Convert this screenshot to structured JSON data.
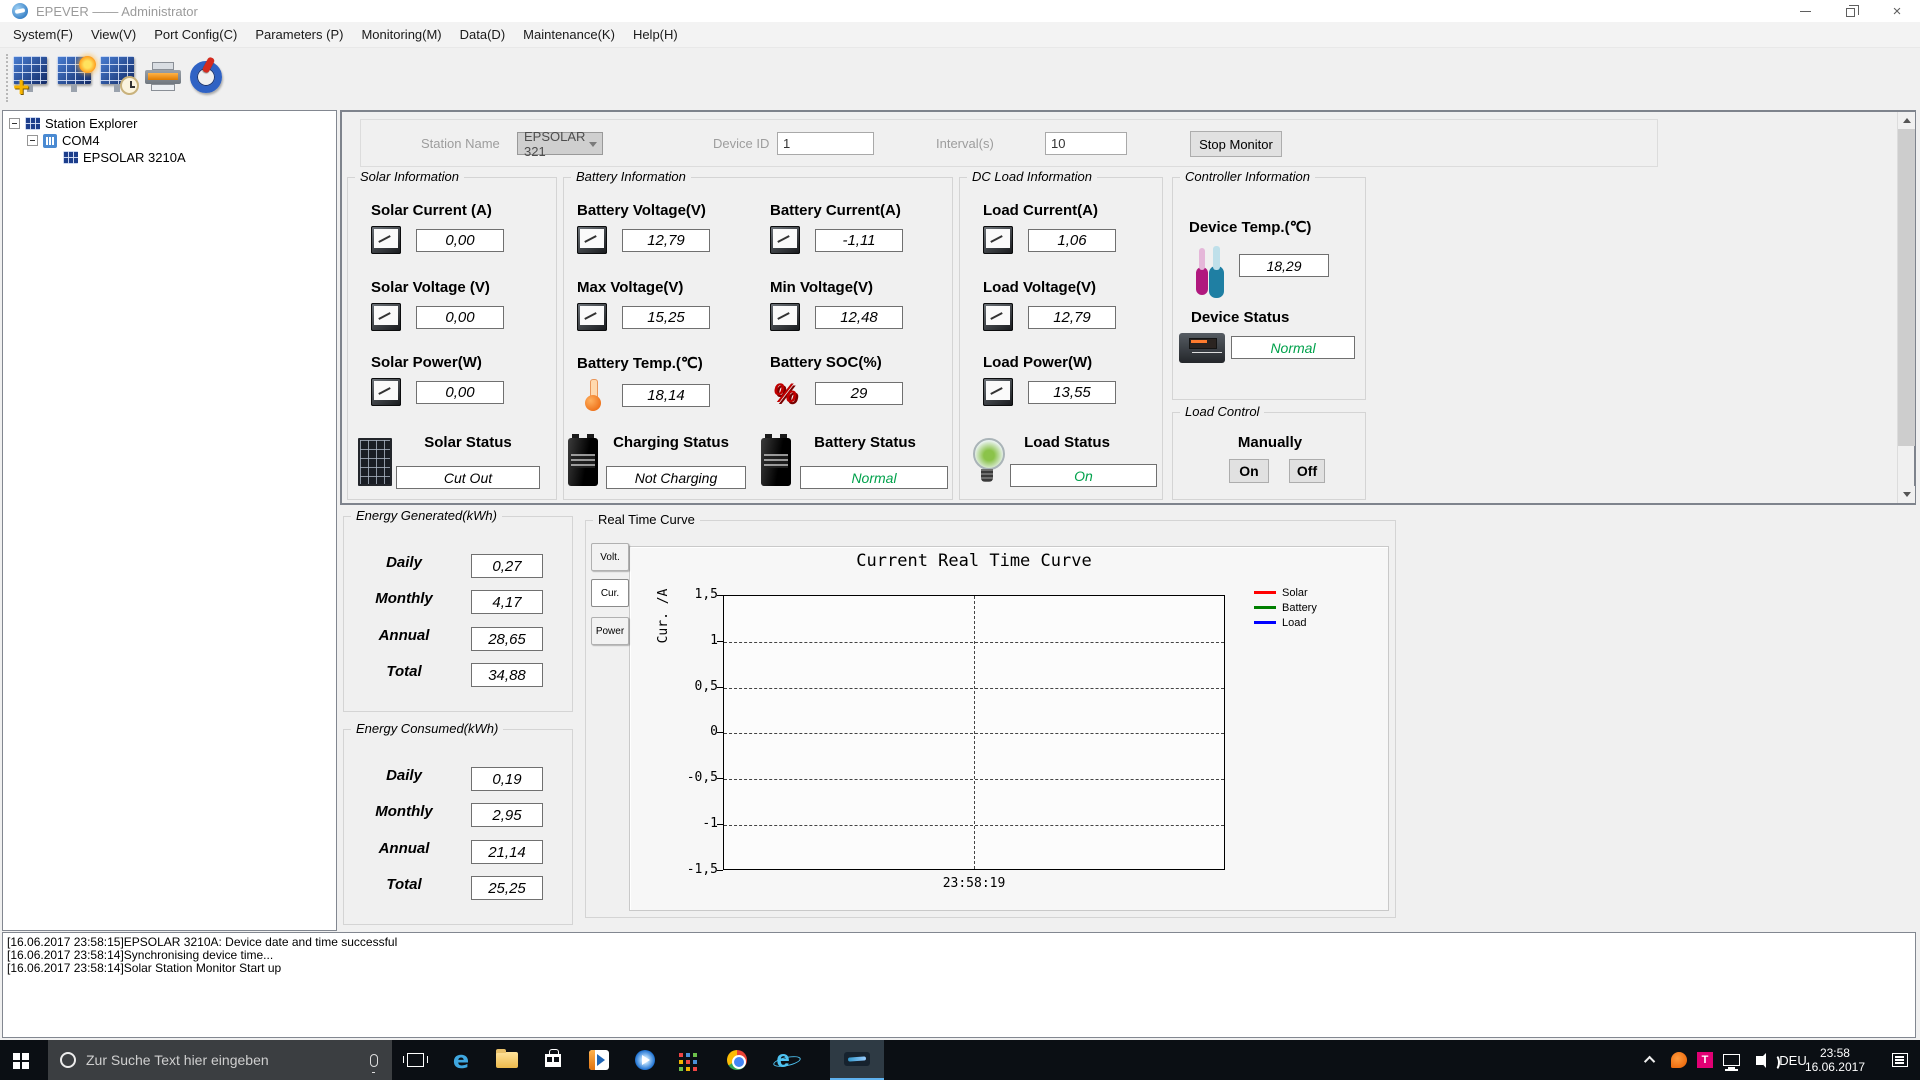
{
  "window": {
    "title": "EPEVER —— Administrator"
  },
  "menu": {
    "items": [
      "System(F)",
      "View(V)",
      "Port Config(C)",
      "Parameters (P)",
      "Monitoring(M)",
      "Data(D)",
      "Maintenance(K)",
      "Help(H)"
    ]
  },
  "toolbar": {
    "icons": [
      "add-station",
      "station-settings",
      "station-time",
      "print",
      "power"
    ]
  },
  "tree": {
    "root": "Station Explorer",
    "port": "COM4",
    "device": "EPSOLAR 3210A"
  },
  "monitor_bar": {
    "station_name_label": "Station Name",
    "station_name_value": "EPSOLAR 321",
    "device_id_label": "Device ID",
    "device_id_value": "1",
    "interval_label": "Interval(s)",
    "interval_value": "10",
    "stop_button_label": "Stop Monitor"
  },
  "panels": {
    "solar": {
      "title": "Solar Information",
      "fields": [
        {
          "label": "Solar Current (A)",
          "value": "0,00"
        },
        {
          "label": "Solar Voltage (V)",
          "value": "0,00"
        },
        {
          "label": "Solar Power(W)",
          "value": "0,00"
        }
      ],
      "status": {
        "label": "Solar Status",
        "value": "Cut Out",
        "color": "#000000"
      }
    },
    "battery": {
      "title": "Battery Information",
      "fields": [
        {
          "label": "Battery Voltage(V)",
          "value": "12,79"
        },
        {
          "label": "Battery Current(A)",
          "value": "-1,11"
        },
        {
          "label": "Max Voltage(V)",
          "value": "15,25"
        },
        {
          "label": "Min Voltage(V)",
          "value": "12,48"
        },
        {
          "label": "Battery Temp.(℃)",
          "value": "18,14"
        },
        {
          "label": "Battery SOC(%)",
          "value": "29"
        }
      ],
      "charging_status": {
        "label": "Charging Status",
        "value": "Not Charging",
        "color": "#000000"
      },
      "battery_status": {
        "label": "Battery Status",
        "value": "Normal",
        "color": "#00a14b"
      }
    },
    "dc_load": {
      "title": "DC Load Information",
      "fields": [
        {
          "label": "Load Current(A)",
          "value": "1,06"
        },
        {
          "label": "Load Voltage(V)",
          "value": "12,79"
        },
        {
          "label": "Load Power(W)",
          "value": "13,55"
        }
      ],
      "status": {
        "label": "Load Status",
        "value": "On",
        "color": "#00a14b"
      }
    },
    "controller": {
      "title": "Controller Information",
      "temp": {
        "label": "Device Temp.(℃)",
        "value": "18,29"
      },
      "status": {
        "label": "Device Status",
        "value": "Normal",
        "color": "#00a14b"
      }
    },
    "load_control": {
      "title": "Load Control",
      "manually_label": "Manually",
      "on_label": "On",
      "off_label": "Off"
    }
  },
  "energy_generated": {
    "title": "Energy Generated(kWh)",
    "rows": [
      {
        "label": "Daily",
        "value": "0,27"
      },
      {
        "label": "Monthly",
        "value": "4,17"
      },
      {
        "label": "Annual",
        "value": "28,65"
      },
      {
        "label": "Total",
        "value": "34,88"
      }
    ]
  },
  "energy_consumed": {
    "title": "Energy Consumed(kWh)",
    "rows": [
      {
        "label": "Daily",
        "value": "0,19"
      },
      {
        "label": "Monthly",
        "value": "2,95"
      },
      {
        "label": "Annual",
        "value": "21,14"
      },
      {
        "label": "Total",
        "value": "25,25"
      }
    ]
  },
  "rtc": {
    "title": "Real Time Curve",
    "tabs": [
      "Volt.",
      "Cur.",
      "Power"
    ],
    "active_tab": "Cur.",
    "chart_title": "Current Real Time Curve",
    "ylabel": "Cur. /A",
    "yticks": [
      "1,5",
      "1",
      "0,5",
      "0",
      "-0,5",
      "-1",
      "-1,5"
    ],
    "xlabel": "23:58:19",
    "legend": [
      {
        "label": "Solar",
        "color": "#ff0000"
      },
      {
        "label": "Battery",
        "color": "#007f00"
      },
      {
        "label": "Load",
        "color": "#0000ff"
      }
    ]
  },
  "chart_data": {
    "type": "line",
    "title": "Current Real Time Curve",
    "xlabel": "",
    "ylabel": "Cur. /A",
    "ylim": [
      -1.5,
      1.5
    ],
    "yticks": [
      1.5,
      1,
      0.5,
      0,
      -0.5,
      -1,
      -1.5
    ],
    "x_tick_labels": [
      "23:58:19"
    ],
    "grid": true,
    "legend_position": "right",
    "series": [
      {
        "name": "Solar",
        "color": "#ff0000",
        "values": []
      },
      {
        "name": "Battery",
        "color": "#007f00",
        "values": []
      },
      {
        "name": "Load",
        "color": "#0000ff",
        "values": []
      }
    ]
  },
  "log": {
    "lines": [
      "[16.06.2017 23:58:15]EPSOLAR 3210A: Device date and time successful",
      "[16.06.2017 23:58:14]Synchronising device time...",
      "[16.06.2017 23:58:14]Solar Station Monitor Start up"
    ]
  },
  "taskbar": {
    "search_placeholder": "Zur Suche Text hier eingeben",
    "apps": [
      "task-view",
      "edge",
      "file-explorer",
      "store",
      "media-player",
      "dvd-player",
      "app-grid",
      "chrome",
      "internet-explorer",
      "epever"
    ],
    "tray": {
      "icons": [
        "tray-expand",
        "avast",
        "telekom",
        "network",
        "volume"
      ],
      "lang": "DEU",
      "time": "23:58",
      "date": "16.06.2017"
    }
  }
}
